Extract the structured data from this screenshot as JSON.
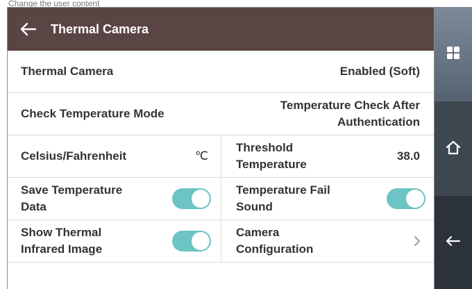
{
  "caption": "Change the user content",
  "header": {
    "title": "Thermal Camera"
  },
  "rows": {
    "thermal_camera": {
      "label": "Thermal Camera",
      "value": "Enabled (Soft)"
    },
    "check_mode": {
      "label": "Check Temperature Mode",
      "value_line1": "Temperature Check After",
      "value_line2": "Authentication"
    },
    "units": {
      "label": "Celsius/Fahrenheit",
      "value": "℃"
    },
    "threshold": {
      "label_line1": "Threshold",
      "label_line2": "Temperature",
      "value": "38.0"
    },
    "save_data": {
      "label_line1": "Save Temperature",
      "label_line2": "Data",
      "enabled": true
    },
    "fail_sound": {
      "label_line1": "Temperature Fail",
      "label_line2": "Sound",
      "enabled": true
    },
    "show_ir": {
      "label_line1": "Show Thermal",
      "label_line2": "Infrared Image",
      "enabled": true
    },
    "camera_config": {
      "label_line1": "Camera",
      "label_line2": "Configuration"
    }
  },
  "sidebar": {
    "icons": [
      "grid-icon",
      "home-icon",
      "back-arrow-icon"
    ]
  },
  "colors": {
    "header": "#5a4545",
    "toggle_on": "#6cc4c4",
    "sidebar_top": "#667788",
    "sidebar_mid": "#3e4650",
    "sidebar_bottom": "#2c323a"
  }
}
